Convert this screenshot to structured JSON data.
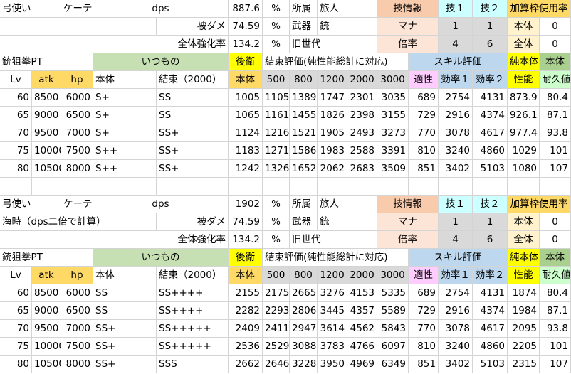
{
  "colors": {
    "green": "#c6e0b4",
    "yellow": "#ffff00",
    "gray": "#d9d9d9",
    "blue": "#bdd7ee",
    "pink": "#ffccff",
    "light_green": "#a9d08e",
    "orange": "#f8cbad",
    "light_orange": "#fce4d6",
    "cyan": "#ccffff",
    "mint": "#ccffcc",
    "gold": "#ffd966",
    "light_yellow": "#fff2cc",
    "white": "#ffffff"
  },
  "blocks": [
    {
      "info": {
        "row1": [
          "弓使い",
          "ケーテ",
          "dps",
          "887.6",
          "%",
          "所属",
          "旅人",
          "技情報",
          "技１",
          "技２",
          "加算枠使用率"
        ],
        "row2": [
          "",
          "",
          "被ダメ",
          "74.59",
          "%",
          "武器",
          "銃",
          "マナ",
          "1",
          "1",
          "本体",
          "0"
        ],
        "row3": [
          "",
          "",
          "全体強化率",
          "134.2",
          "%",
          "旧世代",
          "",
          "倍率",
          "4",
          "6",
          "全体",
          "0"
        ]
      },
      "head1": [
        "銃狙拳PT",
        "いつもの",
        "後衛",
        "結束評価(純性能総計に対応)",
        "スキル評価",
        "純本体",
        "本体"
      ],
      "head2": [
        "Lv",
        "atk",
        "hp",
        "本体",
        "結束（2000）",
        "本体",
        "500",
        "800",
        "1200",
        "2000",
        "3000",
        "適性",
        "効率１",
        "効率２",
        "性能",
        "耐久値"
      ],
      "rows": [
        [
          "60",
          "8500",
          "6000",
          "S+",
          "SS",
          "1005",
          "1105",
          "1389",
          "1747",
          "2301",
          "3035",
          "689",
          "2754",
          "4131",
          "873.9",
          "80.4"
        ],
        [
          "65",
          "9000",
          "6500",
          "S+",
          "SS",
          "1065",
          "1161",
          "1455",
          "1826",
          "2398",
          "3155",
          "729",
          "2916",
          "4374",
          "926.1",
          "87.1"
        ],
        [
          "70",
          "9500",
          "7000",
          "S+",
          "SS+",
          "1124",
          "1216",
          "1521",
          "1905",
          "2493",
          "3273",
          "770",
          "3078",
          "4617",
          "977.4",
          "93.8"
        ],
        [
          "75",
          "10000",
          "7500",
          "S++",
          "SS+",
          "1183",
          "1271",
          "1586",
          "1983",
          "2588",
          "3391",
          "810",
          "3240",
          "4860",
          "1029",
          "101"
        ],
        [
          "80",
          "10500",
          "8000",
          "S++",
          "SS+",
          "1242",
          "1326",
          "1652",
          "2062",
          "2683",
          "3509",
          "851",
          "3402",
          "5103",
          "1080",
          "107"
        ]
      ]
    },
    {
      "info": {
        "row1": [
          "弓使い",
          "ケーテ",
          "dps",
          "1902",
          "%",
          "所属",
          "旅人",
          "技情報",
          "技１",
          "技２",
          "加算枠使用率"
        ],
        "row2": [
          "海時（dps二倍で計算）",
          "",
          "被ダメ",
          "74.59",
          "%",
          "武器",
          "銃",
          "マナ",
          "1",
          "1",
          "本体",
          "0"
        ],
        "row3": [
          "",
          "",
          "全体強化率",
          "134.2",
          "%",
          "旧世代",
          "",
          "倍率",
          "4",
          "6",
          "全体",
          "0"
        ]
      },
      "head1": [
        "銃狙拳PT",
        "いつもの",
        "後衛",
        "結束評価(純性能総計に対応)",
        "スキル評価",
        "純本体",
        "本体"
      ],
      "head2": [
        "Lv",
        "atk",
        "hp",
        "本体",
        "結束（2000）",
        "本体",
        "500",
        "800",
        "1200",
        "2000",
        "3000",
        "適性",
        "効率１",
        "効率２",
        "性能",
        "耐久値"
      ],
      "rows": [
        [
          "60",
          "8500",
          "6000",
          "SS",
          "SS++++",
          "2155",
          "2175",
          "2665",
          "3276",
          "4153",
          "5335",
          "689",
          "2754",
          "4131",
          "1874",
          "80.4"
        ],
        [
          "65",
          "9000",
          "6500",
          "SS",
          "SS++++",
          "2282",
          "2293",
          "2806",
          "3445",
          "4357",
          "5589",
          "729",
          "2916",
          "4374",
          "1984",
          "87.1"
        ],
        [
          "70",
          "9500",
          "7000",
          "SS+",
          "SS+++++",
          "2409",
          "2411",
          "2947",
          "3614",
          "4562",
          "5843",
          "770",
          "3078",
          "4617",
          "2095",
          "93.8"
        ],
        [
          "75",
          "10000",
          "7500",
          "SS+",
          "SS+++++",
          "2536",
          "2529",
          "3088",
          "3783",
          "4766",
          "6097",
          "810",
          "3240",
          "4860",
          "2205",
          "101"
        ],
        [
          "80",
          "10500",
          "8000",
          "SS+",
          "SSS",
          "2662",
          "2646",
          "3228",
          "3950",
          "4969",
          "6349",
          "851",
          "3402",
          "5103",
          "2315",
          "107"
        ]
      ]
    }
  ]
}
